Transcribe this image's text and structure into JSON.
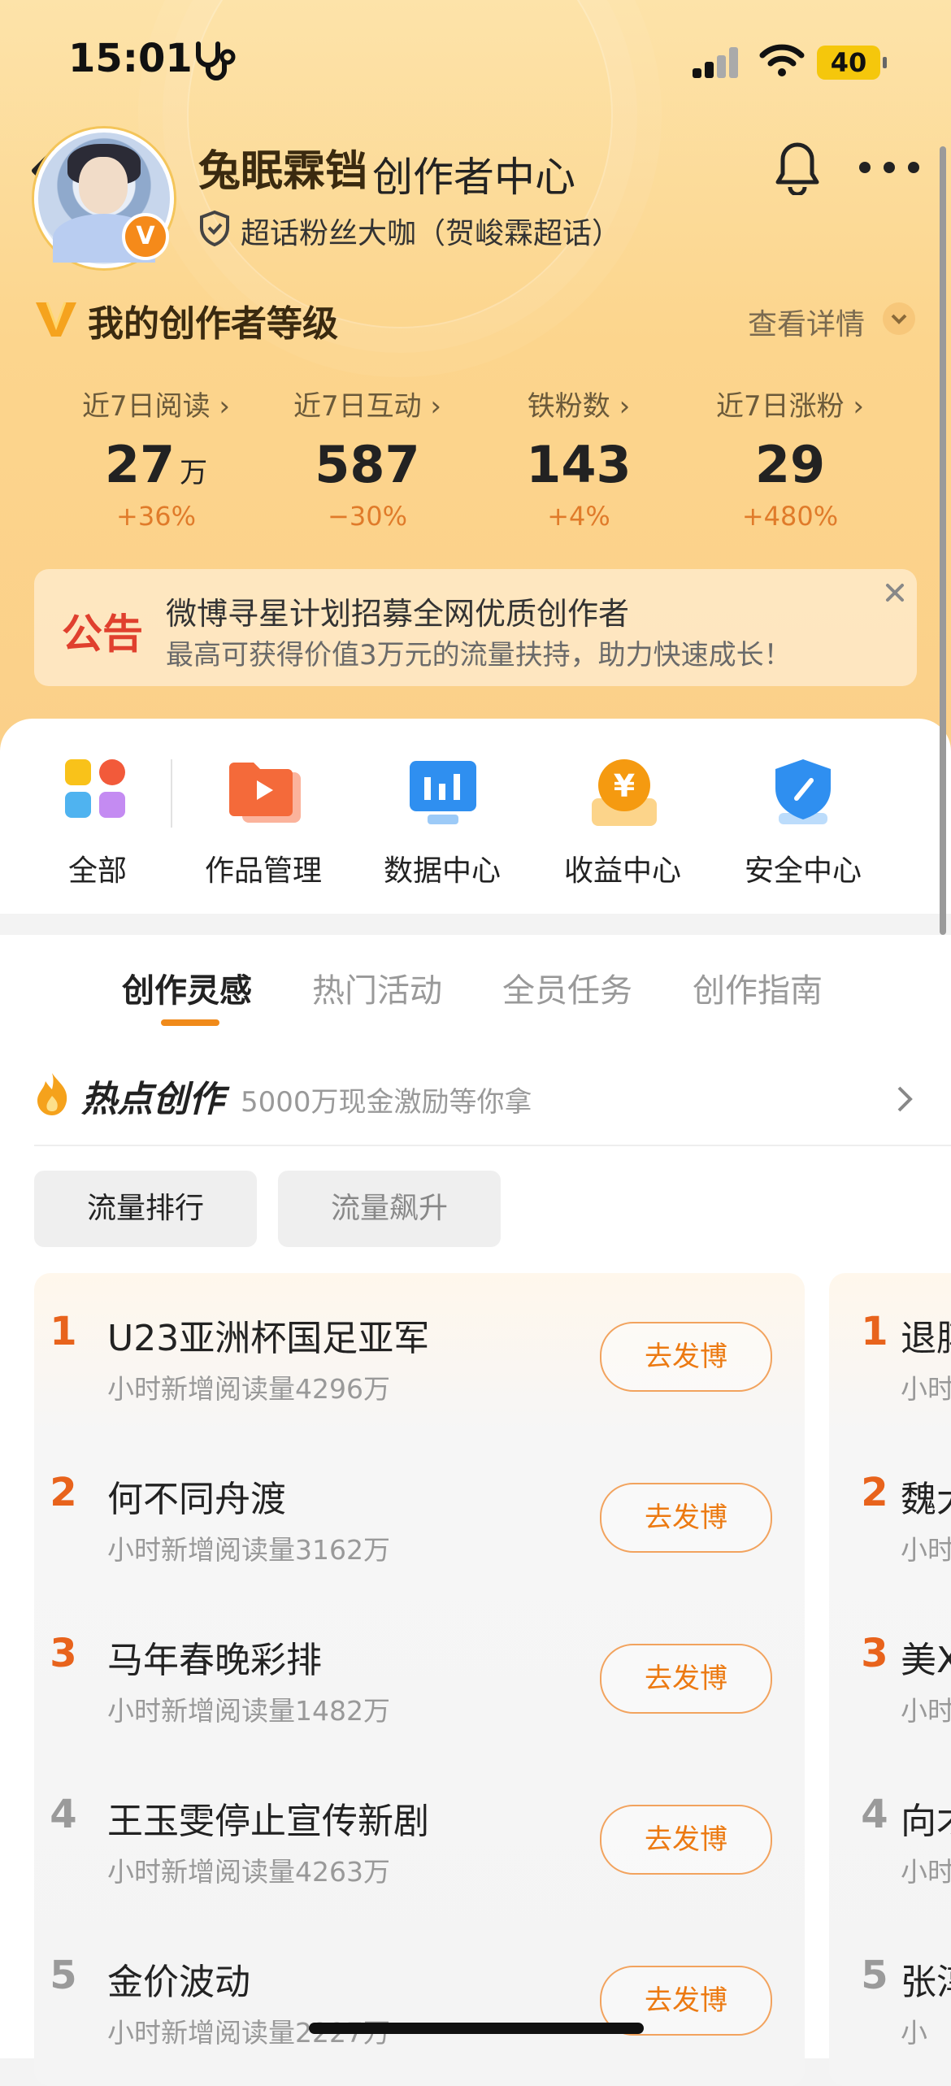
{
  "status_bar": {
    "time": "15:01",
    "battery": "40"
  },
  "header": {
    "username": "兔眠霖铛",
    "page_title": "创作者中心",
    "fan_badge": "超话粉丝大咖（贺峻霖超话）",
    "verified_mark": "V"
  },
  "level": {
    "title": "我的创作者等级",
    "detail_link": "查看详情"
  },
  "metrics": [
    {
      "label": "近7日阅读",
      "value": "27",
      "unit": "万",
      "change": "+36%"
    },
    {
      "label": "近7日互动",
      "value": "587",
      "unit": "",
      "change": "−30%"
    },
    {
      "label": "铁粉数",
      "value": "143",
      "unit": "",
      "change": "+4%"
    },
    {
      "label": "近7日涨粉",
      "value": "29",
      "unit": "",
      "change": "+480%"
    }
  ],
  "notice": {
    "tag": "公告",
    "line1": "微博寻星计划招募全网优质创作者",
    "line2": "最高可获得价值3万元的流量扶持，助力快速成长！"
  },
  "tools": [
    {
      "label": "全部"
    },
    {
      "label": "作品管理"
    },
    {
      "label": "数据中心"
    },
    {
      "label": "收益中心"
    },
    {
      "label": "安全中心"
    }
  ],
  "tabs": [
    "创作灵感",
    "热门活动",
    "全员任务",
    "创作指南"
  ],
  "hot": {
    "title": "热点创作",
    "subtitle": "5000万现金激励等你拿"
  },
  "chips": [
    "流量排行",
    "流量飙升"
  ],
  "ranking": [
    {
      "rank": "1",
      "title": "U23亚洲杯国足亚军",
      "reads": "小时新增阅读量4296万",
      "button": "去发博"
    },
    {
      "rank": "2",
      "title": "何不同舟渡",
      "reads": "小时新增阅读量3162万",
      "button": "去发博"
    },
    {
      "rank": "3",
      "title": "马年春晚彩排",
      "reads": "小时新增阅读量1482万",
      "button": "去发博"
    },
    {
      "rank": "4",
      "title": "王玉雯停止宣传新剧",
      "reads": "小时新增阅读量4263万",
      "button": "去发博"
    },
    {
      "rank": "5",
      "title": "金价波动",
      "reads": "小时新增阅读量2227万",
      "button": "去发博"
    }
  ],
  "ranking_next": [
    {
      "rank": "1",
      "title": "退膊",
      "reads": "小时"
    },
    {
      "rank": "2",
      "title": "魏大",
      "reads": "小时"
    },
    {
      "rank": "3",
      "title": "美X",
      "reads": "小时"
    },
    {
      "rank": "4",
      "title": "向才",
      "reads": "小时"
    },
    {
      "rank": "5",
      "title": "张淳",
      "reads": "小"
    }
  ],
  "colors": {
    "accent": "#ec7a12",
    "rank_top": "#e8631c",
    "rank_other": "#9a9a9a",
    "notice_red": "#e0402e"
  }
}
